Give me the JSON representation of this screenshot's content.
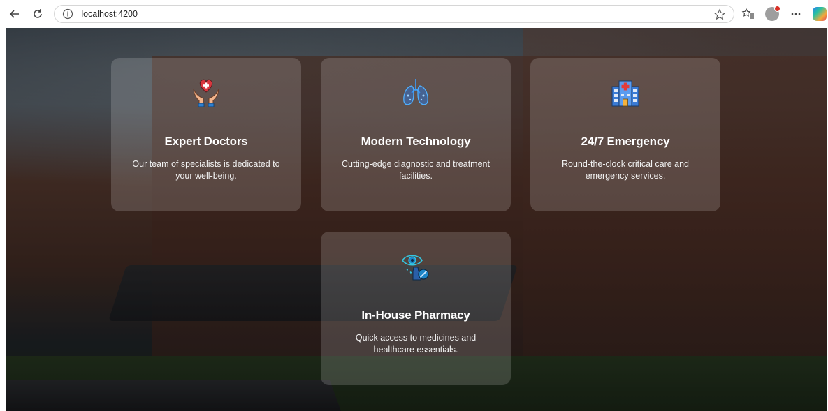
{
  "browser": {
    "url": "localhost:4200",
    "icons": {
      "back": "back-arrow-icon",
      "reload": "reload-icon",
      "info": "info-icon",
      "favorite": "star-icon",
      "favorites_list": "favorites-icon",
      "more": "more-icon"
    }
  },
  "features": [
    {
      "title": "Expert Doctors",
      "description": "Our team of specialists is dedicated to your well-being.",
      "icon": "heart-hands-icon"
    },
    {
      "title": "Modern Technology",
      "description": "Cutting-edge diagnostic and treatment facilities.",
      "icon": "lungs-icon"
    },
    {
      "title": "24/7 Emergency",
      "description": "Round-the-clock critical care and emergency services.",
      "icon": "hospital-icon"
    },
    {
      "title": "In-House Pharmacy",
      "description": "Quick access to medicines and healthcare essentials.",
      "icon": "eye-drops-icon"
    }
  ],
  "colors": {
    "card_bg": "rgba(255,255,255,0.16)",
    "text": "#ffffff"
  }
}
